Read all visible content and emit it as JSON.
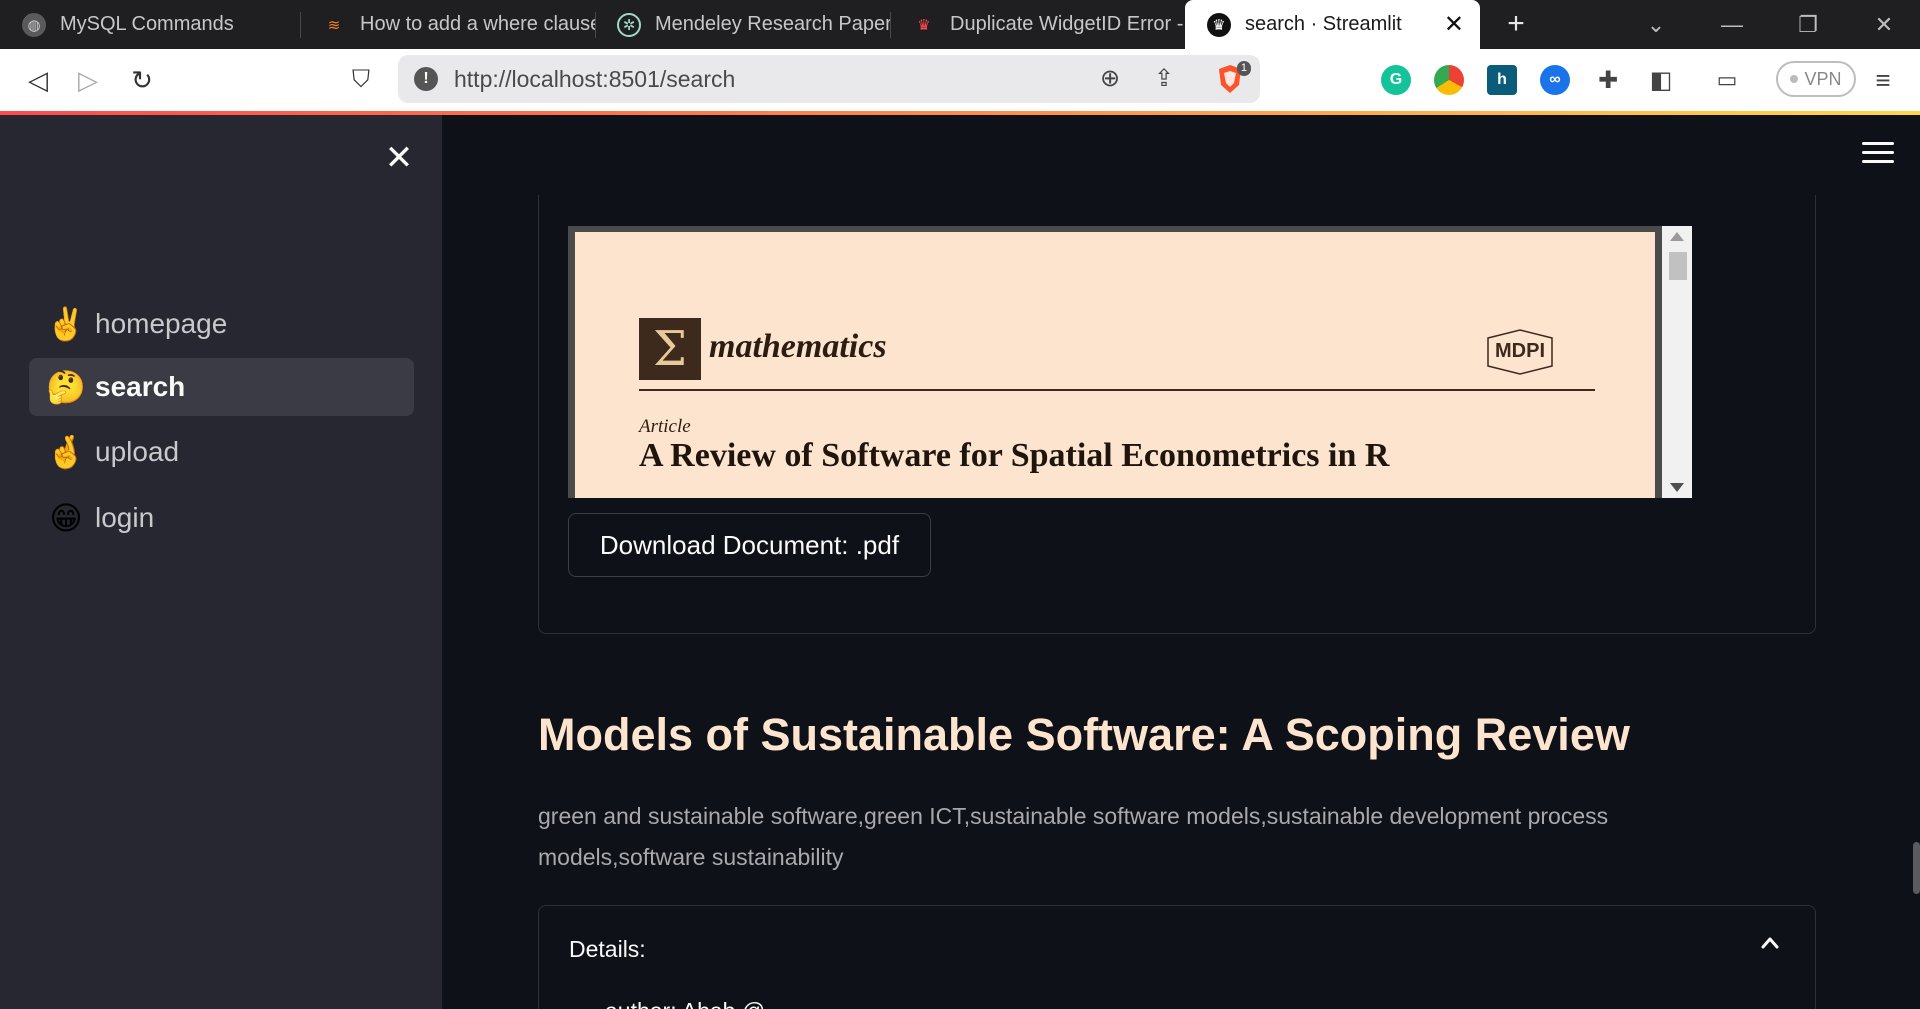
{
  "browser": {
    "tabs": [
      {
        "title": "MySQL Commands",
        "icon": "globe-icon"
      },
      {
        "title": "How to add a where clause",
        "icon": "stackoverflow-icon"
      },
      {
        "title": "Mendeley Research Paper",
        "icon": "chatgpt-icon"
      },
      {
        "title": "Duplicate WidgetID Error -",
        "icon": "streamlit-icon"
      },
      {
        "title": "search · Streamlit",
        "icon": "streamlit-crown-icon"
      }
    ],
    "new_tab_glyph": "+",
    "url": "http://localhost:8501/search",
    "brave_badge": "1",
    "vpn_label": "VPN"
  },
  "sidebar": {
    "items": [
      {
        "label": "homepage",
        "emoji": "✌️",
        "active": false
      },
      {
        "label": "search",
        "emoji": "🤔",
        "active": true
      },
      {
        "label": "upload",
        "emoji": "🤞",
        "active": false
      },
      {
        "label": "login",
        "emoji": "😁",
        "active": false
      }
    ]
  },
  "main": {
    "pdf_preview": {
      "journal": "mathematics",
      "journal_glyph": "Σ",
      "publisher": "MDPI",
      "article_type": "Article",
      "title": "A Review of Software for Spatial Econometrics in R"
    },
    "download_button": "Download Document: .pdf",
    "result_title": "Models of Sustainable Software: A Scoping Review",
    "result_keywords": "green and sustainable software,green ICT,sustainable software models,sustainable development process models,software sustainability",
    "details_label": "Details:",
    "details_partial": "author: Ahab @ ..."
  },
  "colors": {
    "app_bg": "#0e1117",
    "sidebar_bg": "#262730",
    "title_color": "#fde4cf",
    "pdf_page_bg": "#fde4cf"
  }
}
